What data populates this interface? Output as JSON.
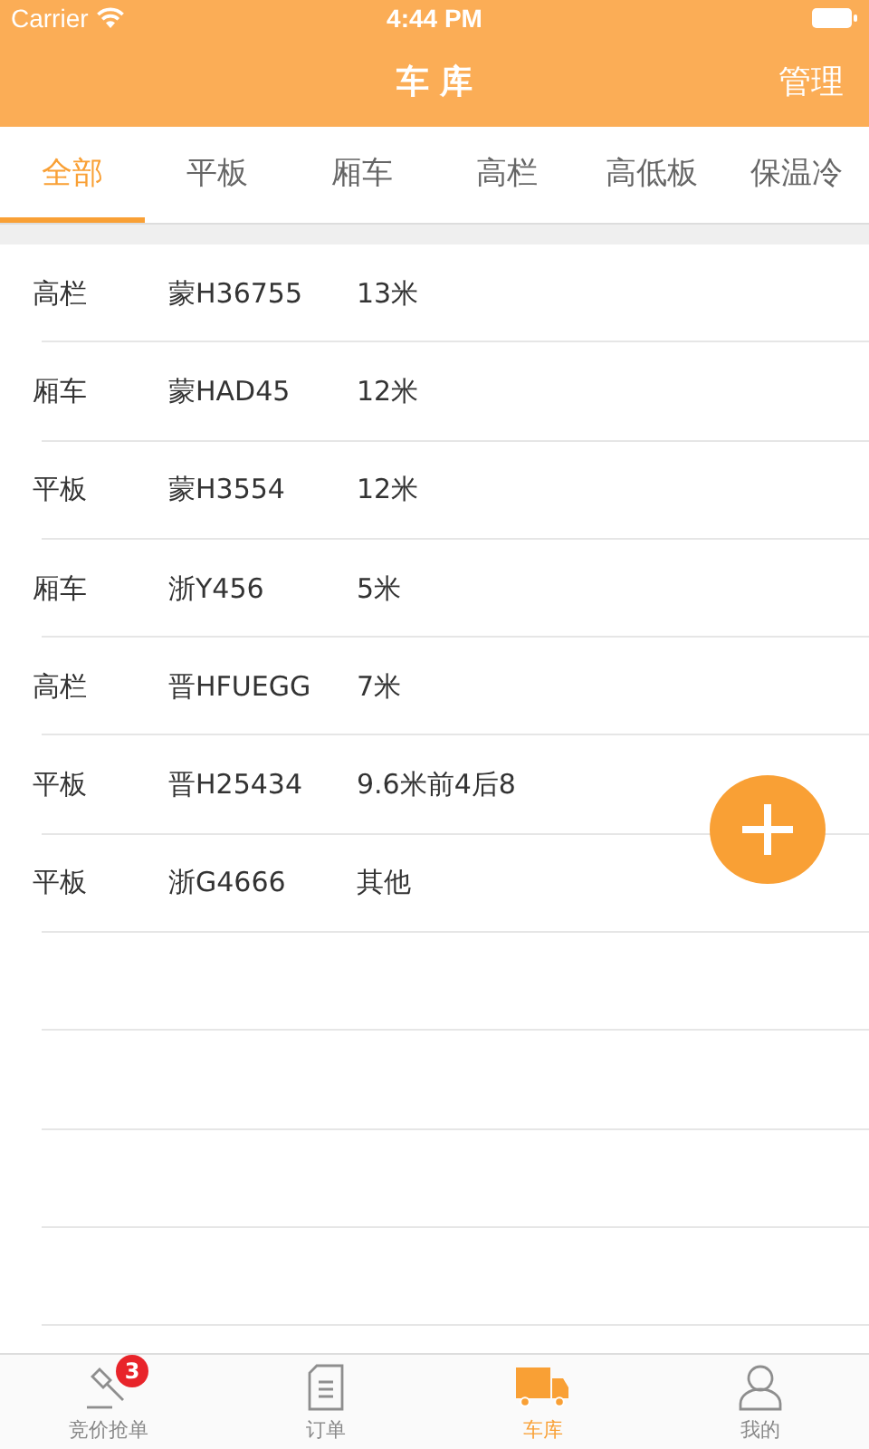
{
  "status_bar": {
    "carrier": "Carrier",
    "time": "4:44 PM"
  },
  "nav": {
    "title": "车 库",
    "action": "管理"
  },
  "tabs": [
    {
      "label": "全部",
      "selected": true
    },
    {
      "label": "平板",
      "selected": false
    },
    {
      "label": "厢车",
      "selected": false
    },
    {
      "label": "高栏",
      "selected": false
    },
    {
      "label": "高低板",
      "selected": false
    },
    {
      "label": "保温冷",
      "selected": false
    }
  ],
  "vehicles": [
    {
      "type": "高栏",
      "plate": "蒙H36755",
      "length": "13米"
    },
    {
      "type": "厢车",
      "plate": "蒙HAD45",
      "length": "12米"
    },
    {
      "type": "平板",
      "plate": "蒙H3554",
      "length": "12米"
    },
    {
      "type": "厢车",
      "plate": "浙Y456",
      "length": "5米"
    },
    {
      "type": "高栏",
      "plate": "晋HFUEGG",
      "length": "7米"
    },
    {
      "type": "平板",
      "plate": "晋H25434",
      "length": "9.6米前4后8"
    },
    {
      "type": "平板",
      "plate": "浙G4666",
      "length": "其他"
    }
  ],
  "tab_bar": [
    {
      "kind": "gavel",
      "label": "竞价抢单",
      "badge": "3",
      "selected": false
    },
    {
      "kind": "document",
      "label": "订单",
      "selected": false
    },
    {
      "kind": "truck",
      "label": "车库",
      "selected": true
    },
    {
      "kind": "person",
      "label": "我的",
      "selected": false
    }
  ]
}
